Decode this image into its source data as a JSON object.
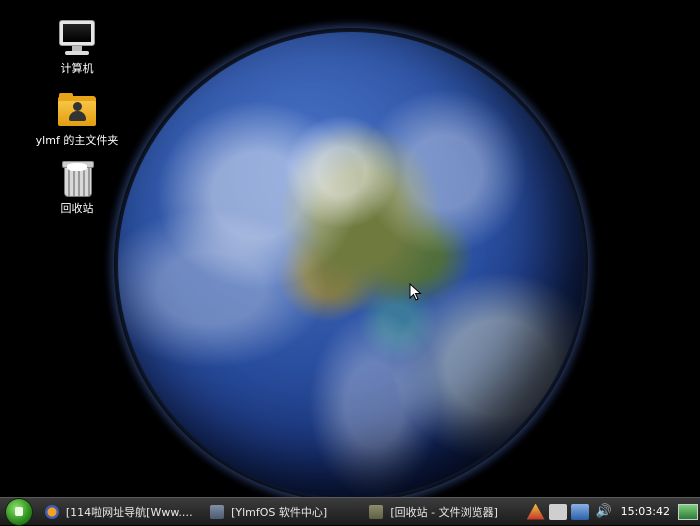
{
  "desktop": {
    "icons": [
      {
        "label": "计算机",
        "icon": "computer-icon"
      },
      {
        "label": "ylmf 的主文件夹",
        "icon": "home-folder-icon"
      },
      {
        "label": "回收站",
        "icon": "trash-icon"
      }
    ],
    "wallpaper": "earth-globe"
  },
  "taskbar": {
    "start_icon": "start-menu-icon",
    "tasks": [
      {
        "label": "[114啦网址导航[Www.…",
        "icon": "firefox-icon"
      },
      {
        "label": "[YlmfOS 软件中心]",
        "icon": "software-center-icon"
      },
      {
        "label": "[回收站 - 文件浏览器]",
        "icon": "file-browser-icon"
      }
    ],
    "tray": [
      "alert-icon",
      "keyboard-icon",
      "network-icon",
      "volume-icon"
    ],
    "clock": "15:03:42",
    "show_desktop_icon": "show-desktop-icon"
  },
  "colors": {
    "taskbar_bg": "#2a2a2a",
    "desktop_bg": "#000000",
    "start_green": "#2e8a1f"
  }
}
